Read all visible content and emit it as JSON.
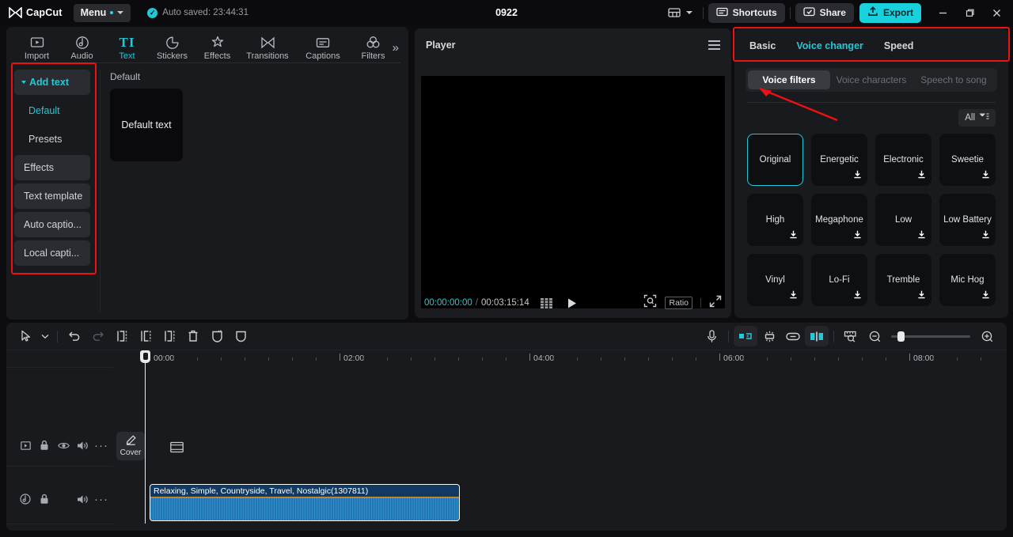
{
  "app": {
    "brand": "CapCut",
    "menu_label": "Menu",
    "autosave_text": "Auto saved: 23:44:31",
    "project_title": "0922"
  },
  "topbar": {
    "layout_icon": "layout-grid-icon",
    "shortcuts_label": "Shortcuts",
    "share_label": "Share",
    "export_label": "Export",
    "minimize": "minimize-icon",
    "maximize": "maximize-icon",
    "close": "close-icon"
  },
  "tooltabs": [
    {
      "label": "Import",
      "icon": "import-icon",
      "active": false
    },
    {
      "label": "Audio",
      "icon": "audio-icon",
      "active": false
    },
    {
      "label": "Text",
      "icon": "text-icon",
      "active": true
    },
    {
      "label": "Stickers",
      "icon": "stickers-icon",
      "active": false
    },
    {
      "label": "Effects",
      "icon": "effects-icon",
      "active": false
    },
    {
      "label": "Transitions",
      "icon": "transitions-icon",
      "active": false
    },
    {
      "label": "Captions",
      "icon": "captions-icon",
      "active": false
    },
    {
      "label": "Filters",
      "icon": "filters-icon",
      "active": false
    }
  ],
  "left_nav": {
    "items": [
      {
        "label": "Add text",
        "type": "group"
      },
      {
        "label": "Default",
        "type": "sub-active"
      },
      {
        "label": "Presets",
        "type": "sub"
      },
      {
        "label": "Effects",
        "type": "box"
      },
      {
        "label": "Text template",
        "type": "box"
      },
      {
        "label": "Auto captio...",
        "type": "box"
      },
      {
        "label": "Local capti...",
        "type": "box"
      }
    ]
  },
  "left_content": {
    "section_label": "Default",
    "thumb_label": "Default text"
  },
  "player": {
    "title": "Player",
    "current_time": "00:00:00:00",
    "separator": "/",
    "total_time": "00:03:15:14",
    "frames_icon": "frames-icon",
    "play_icon": "play-icon",
    "crop_icon": "crop-preview-icon",
    "ratio_label": "Ratio",
    "fullscreen_icon": "fullscreen-icon",
    "menu_icon": "player-menu-icon"
  },
  "right_panel": {
    "tabs": [
      {
        "label": "Basic",
        "active": false
      },
      {
        "label": "Voice changer",
        "active": true
      },
      {
        "label": "Speed",
        "active": false
      }
    ],
    "segments": [
      {
        "label": "Voice filters",
        "active": true
      },
      {
        "label": "Voice characters",
        "active": false
      },
      {
        "label": "Speech to song",
        "active": false
      }
    ],
    "filter_button": {
      "label": "All",
      "icon": "filter-list-icon"
    },
    "filters": [
      {
        "label": "Original",
        "selected": true,
        "downloadable": false
      },
      {
        "label": "Energetic",
        "selected": false,
        "downloadable": true
      },
      {
        "label": "Electronic",
        "selected": false,
        "downloadable": true
      },
      {
        "label": "Sweetie",
        "selected": false,
        "downloadable": true
      },
      {
        "label": "High",
        "selected": false,
        "downloadable": true
      },
      {
        "label": "Megaphone",
        "selected": false,
        "downloadable": true
      },
      {
        "label": "Low",
        "selected": false,
        "downloadable": true
      },
      {
        "label": "Low Battery",
        "selected": false,
        "downloadable": true
      },
      {
        "label": "Vinyl",
        "selected": false,
        "downloadable": true
      },
      {
        "label": "Lo-Fi",
        "selected": false,
        "downloadable": true
      },
      {
        "label": "Tremble",
        "selected": false,
        "downloadable": true
      },
      {
        "label": "Mic Hog",
        "selected": false,
        "downloadable": true
      }
    ]
  },
  "timeline": {
    "tools_left": [
      {
        "name": "select-tool-icon",
        "state": "on"
      },
      {
        "name": "select-dropdown-icon",
        "state": "on"
      },
      {
        "name": "undo-icon",
        "state": "on"
      },
      {
        "name": "redo-icon",
        "state": "disabled"
      },
      {
        "name": "split-icon",
        "state": "on"
      },
      {
        "name": "trim-left-icon",
        "state": "on"
      },
      {
        "name": "trim-right-icon",
        "state": "on"
      },
      {
        "name": "delete-icon",
        "state": "on"
      },
      {
        "name": "freeze-icon",
        "state": "on"
      },
      {
        "name": "mask-icon",
        "state": "on"
      }
    ],
    "tools_right": [
      {
        "name": "record-voiceover-icon",
        "state": "on"
      },
      {
        "name": "mirror-icon",
        "state": "active"
      },
      {
        "name": "stabilize-icon",
        "state": "on"
      },
      {
        "name": "link-icon",
        "state": "on"
      },
      {
        "name": "snap-icon",
        "state": "active"
      },
      {
        "name": "ruler-zoom-icon",
        "state": "on"
      },
      {
        "name": "zoom-out-icon",
        "state": "on"
      },
      {
        "name": "zoom-slider",
        "state": "on"
      },
      {
        "name": "zoom-in-icon",
        "state": "on"
      }
    ],
    "ruler_labels": [
      "00:00",
      "02:00",
      "04:00",
      "06:00",
      "08:00"
    ],
    "cover_label": "Cover",
    "video_track_icons": [
      "video-track-icon",
      "lock-icon",
      "eye-icon",
      "volume-icon",
      "more-icon"
    ],
    "audio_track_icons": [
      "audio-track-icon",
      "lock-icon",
      "volume-icon",
      "more-icon"
    ],
    "audio_clip_label": "Relaxing, Simple, Countryside, Travel, Nostalgic(1307811)"
  },
  "colors": {
    "accent": "#22c8d6",
    "export": "#18d1dd",
    "annotation": "#ee1111",
    "audio_clip": "#1d79b8",
    "panel_bg": "#191a1d"
  }
}
